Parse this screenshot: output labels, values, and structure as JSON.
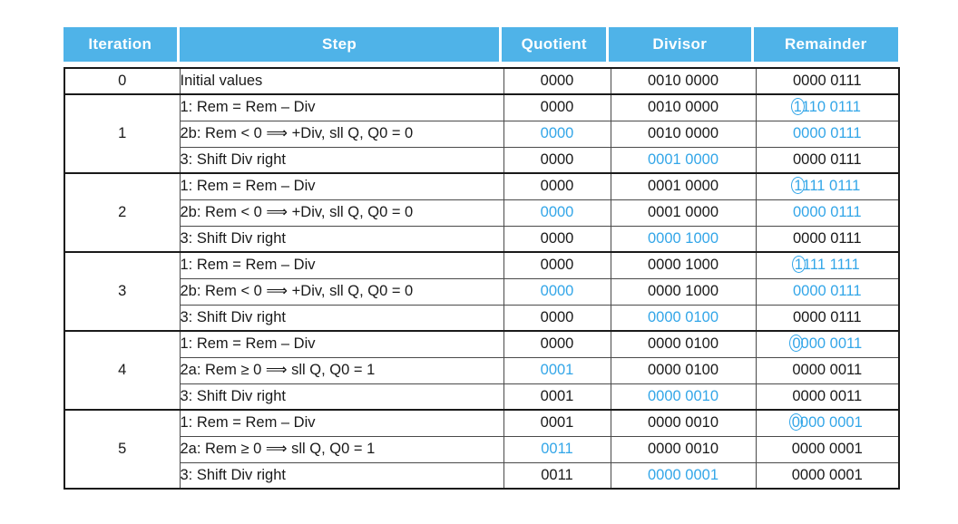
{
  "table": {
    "columns": [
      {
        "key": "iteration",
        "label": "Iteration"
      },
      {
        "key": "step",
        "label": "Step"
      },
      {
        "key": "quotient",
        "label": "Quotient"
      },
      {
        "key": "divisor",
        "label": "Divisor"
      },
      {
        "key": "remainder",
        "label": "Remainder"
      }
    ],
    "header_bg": "#4FB3E8",
    "header_fg": "#ffffff",
    "highlight_color": "#33A6E8",
    "text_color": "#1a1a1a",
    "rows": [
      {
        "iteration": "0",
        "iteration_rowspan": 1,
        "group_start": true,
        "step": "Initial values",
        "quotient": "0000",
        "quotient_hl": false,
        "divisor": "0010 0000",
        "divisor_hl": false,
        "remainder": "0000 0111",
        "remainder_hl": false,
        "remainder_circle": false
      },
      {
        "iteration": "1",
        "iteration_rowspan": 3,
        "group_start": true,
        "step": "1:  Rem = Rem – Div",
        "quotient": "0000",
        "quotient_hl": false,
        "divisor": "0010 0000",
        "divisor_hl": false,
        "remainder": "1110 0111",
        "remainder_hl": true,
        "remainder_circle": true
      },
      {
        "group_start": false,
        "step": "2b:  Rem < 0 ⟹ +Div, sll Q, Q0 = 0",
        "quotient": "0000",
        "quotient_hl": true,
        "divisor": "0010 0000",
        "divisor_hl": false,
        "remainder": "0000 0111",
        "remainder_hl": true,
        "remainder_circle": false
      },
      {
        "group_start": false,
        "step": "3:  Shift Div right",
        "quotient": "0000",
        "quotient_hl": false,
        "divisor": "0001 0000",
        "divisor_hl": true,
        "remainder": "0000 0111",
        "remainder_hl": false,
        "remainder_circle": false
      },
      {
        "iteration": "2",
        "iteration_rowspan": 3,
        "group_start": true,
        "step": "1:  Rem = Rem – Div",
        "quotient": "0000",
        "quotient_hl": false,
        "divisor": "0001 0000",
        "divisor_hl": false,
        "remainder": "1111 0111",
        "remainder_hl": true,
        "remainder_circle": true
      },
      {
        "group_start": false,
        "step": "2b:  Rem < 0 ⟹ +Div, sll Q, Q0 = 0",
        "quotient": "0000",
        "quotient_hl": true,
        "divisor": "0001 0000",
        "divisor_hl": false,
        "remainder": "0000 0111",
        "remainder_hl": true,
        "remainder_circle": false
      },
      {
        "group_start": false,
        "step": "3:  Shift Div right",
        "quotient": "0000",
        "quotient_hl": false,
        "divisor": "0000 1000",
        "divisor_hl": true,
        "remainder": "0000 0111",
        "remainder_hl": false,
        "remainder_circle": false
      },
      {
        "iteration": "3",
        "iteration_rowspan": 3,
        "group_start": true,
        "step": "1:  Rem = Rem – Div",
        "quotient": "0000",
        "quotient_hl": false,
        "divisor": "0000 1000",
        "divisor_hl": false,
        "remainder": "1111 1111",
        "remainder_hl": true,
        "remainder_circle": true
      },
      {
        "group_start": false,
        "step": "2b:  Rem < 0 ⟹ +Div, sll Q, Q0 = 0",
        "quotient": "0000",
        "quotient_hl": true,
        "divisor": "0000 1000",
        "divisor_hl": false,
        "remainder": "0000 0111",
        "remainder_hl": true,
        "remainder_circle": false
      },
      {
        "group_start": false,
        "step": "3:  Shift Div right",
        "quotient": "0000",
        "quotient_hl": false,
        "divisor": "0000 0100",
        "divisor_hl": true,
        "remainder": "0000 0111",
        "remainder_hl": false,
        "remainder_circle": false
      },
      {
        "iteration": "4",
        "iteration_rowspan": 3,
        "group_start": true,
        "step": "1:  Rem = Rem – Div",
        "quotient": "0000",
        "quotient_hl": false,
        "divisor": "0000 0100",
        "divisor_hl": false,
        "remainder": "0000 0011",
        "remainder_hl": true,
        "remainder_circle": true
      },
      {
        "group_start": false,
        "step": "2a:  Rem ≥ 0 ⟹ sll Q, Q0 = 1",
        "quotient": "0001",
        "quotient_hl": true,
        "divisor": "0000 0100",
        "divisor_hl": false,
        "remainder": "0000 0011",
        "remainder_hl": false,
        "remainder_circle": false
      },
      {
        "group_start": false,
        "step": "3:  Shift Div right",
        "quotient": "0001",
        "quotient_hl": false,
        "divisor": "0000 0010",
        "divisor_hl": true,
        "remainder": "0000 0011",
        "remainder_hl": false,
        "remainder_circle": false
      },
      {
        "iteration": "5",
        "iteration_rowspan": 3,
        "group_start": true,
        "step": "1:  Rem = Rem – Div",
        "quotient": "0001",
        "quotient_hl": false,
        "divisor": "0000 0010",
        "divisor_hl": false,
        "remainder": "0000 0001",
        "remainder_hl": true,
        "remainder_circle": true
      },
      {
        "group_start": false,
        "step": "2a:  Rem ≥ 0 ⟹ sll Q, Q0 = 1",
        "quotient": "0011",
        "quotient_hl": true,
        "divisor": "0000 0010",
        "divisor_hl": false,
        "remainder": "0000 0001",
        "remainder_hl": false,
        "remainder_circle": false
      },
      {
        "group_start": false,
        "step": "3:  Shift Div right",
        "quotient": "0011",
        "quotient_hl": false,
        "divisor": "0000 0001",
        "divisor_hl": true,
        "remainder": "0000 0001",
        "remainder_hl": false,
        "remainder_circle": false
      }
    ]
  }
}
